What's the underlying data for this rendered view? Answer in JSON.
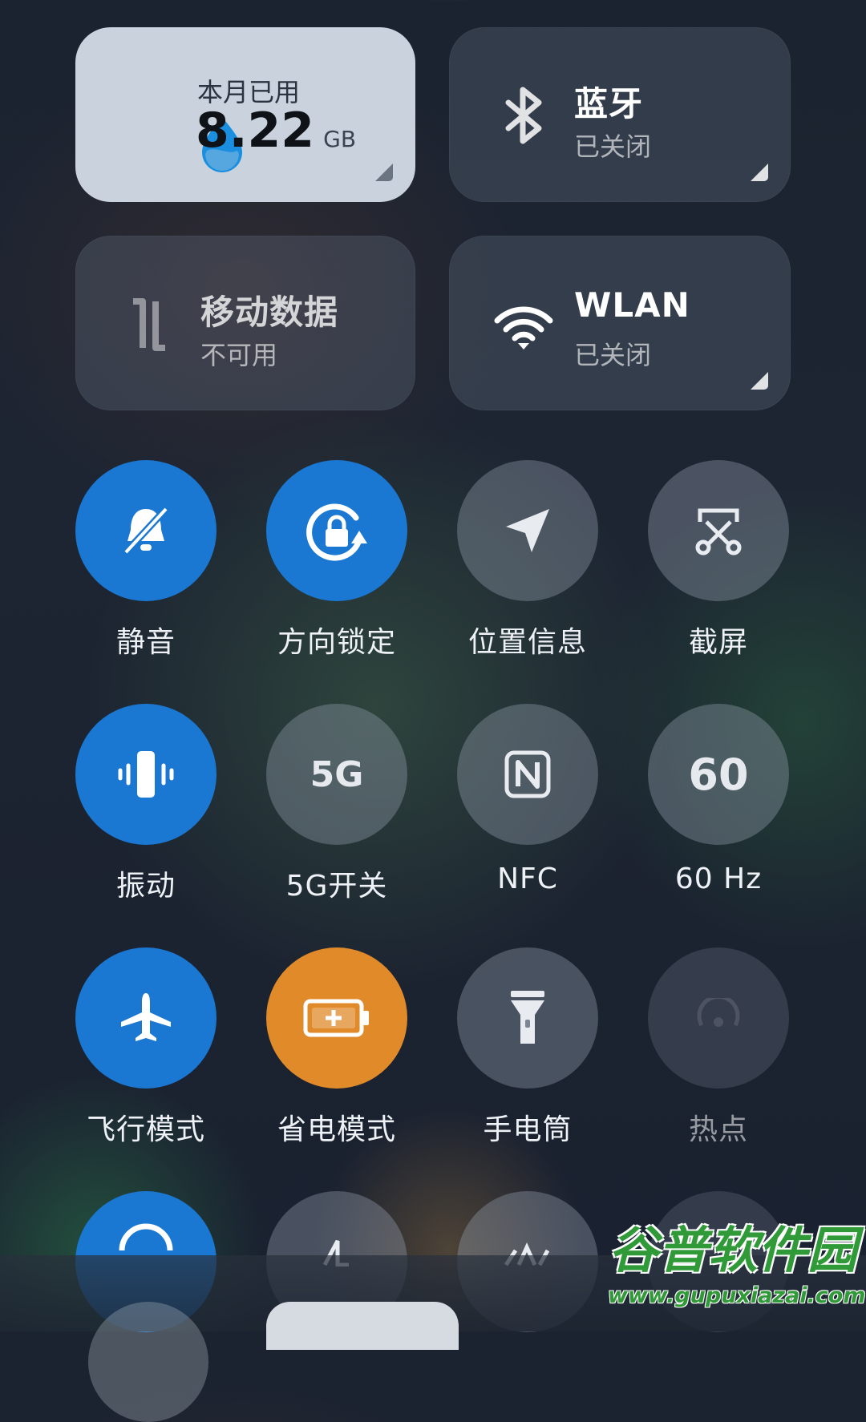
{
  "data_usage": {
    "label": "本月已用",
    "value": "8.22",
    "unit": "GB",
    "icon": "water-drop-icon",
    "accent": "#1a8fe0"
  },
  "bluetooth": {
    "title": "蓝牙",
    "status": "已关闭",
    "icon": "bluetooth-icon"
  },
  "mobile_data": {
    "title": "移动数据",
    "status": "不可用",
    "icon": "mobile-data-arrows-icon"
  },
  "wlan": {
    "title": "WLAN",
    "status": "已关闭",
    "icon": "wifi-icon"
  },
  "toggles": [
    {
      "id": "silent",
      "label": "静音",
      "icon": "bell-off-icon",
      "state": "on",
      "color": "#1a78d2"
    },
    {
      "id": "rotation-lock",
      "label": "方向锁定",
      "icon": "rotation-lock-icon",
      "state": "on",
      "color": "#1a78d2"
    },
    {
      "id": "location",
      "label": "位置信息",
      "icon": "location-arrow-icon",
      "state": "off"
    },
    {
      "id": "screenshot",
      "label": "截屏",
      "icon": "scissors-screenshot-icon",
      "state": "off"
    },
    {
      "id": "vibrate",
      "label": "振动",
      "icon": "vibrate-icon",
      "state": "on",
      "color": "#1a78d2"
    },
    {
      "id": "5g",
      "label": "5G开关",
      "icon": "5g-icon",
      "icon_text": "5G",
      "state": "off"
    },
    {
      "id": "nfc",
      "label": "NFC",
      "icon": "nfc-icon",
      "state": "off"
    },
    {
      "id": "refresh-rate",
      "label": "60 Hz",
      "icon": "refresh-60-icon",
      "icon_text": "60",
      "state": "off"
    },
    {
      "id": "airplane",
      "label": "飞行模式",
      "icon": "airplane-icon",
      "state": "on",
      "color": "#1a78d2"
    },
    {
      "id": "battery-saver",
      "label": "省电模式",
      "icon": "battery-saver-icon",
      "state": "on",
      "color": "#e08a2a"
    },
    {
      "id": "flashlight",
      "label": "手电筒",
      "icon": "flashlight-icon",
      "state": "off"
    },
    {
      "id": "hotspot",
      "label": "热点",
      "icon": "hotspot-icon",
      "state": "disabled"
    }
  ],
  "watermark": {
    "top": "谷普软件园",
    "bottom": "www.gupuxiazai.com"
  }
}
